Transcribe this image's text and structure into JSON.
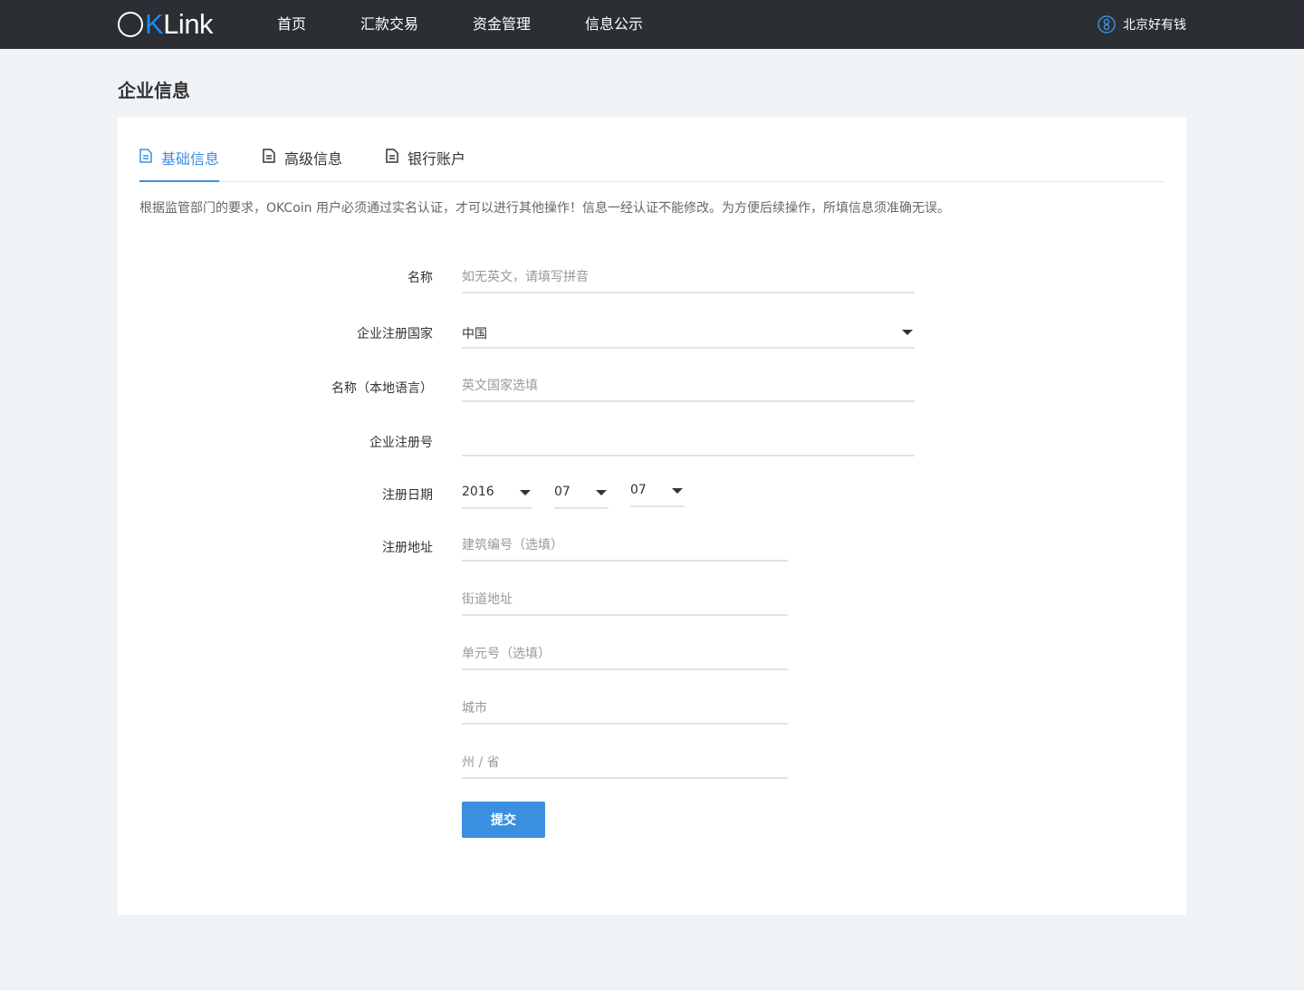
{
  "brand": {
    "logo_o": "O",
    "logo_k": "K",
    "logo_rest": "Link"
  },
  "nav": {
    "items": [
      {
        "label": "首页"
      },
      {
        "label": "汇款交易"
      },
      {
        "label": "资金管理"
      },
      {
        "label": "信息公示"
      }
    ],
    "user_name": "北京好有钱"
  },
  "page_title": "企业信息",
  "tabs": [
    {
      "label": "基础信息",
      "active": true
    },
    {
      "label": "高级信息",
      "active": false
    },
    {
      "label": "银行账户",
      "active": false
    }
  ],
  "notice": "根据监管部门的要求，OKCoin 用户必须通过实名认证，才可以进行其他操作！信息一经认证不能修改。为方便后续操作，所填信息须准确无误。",
  "form": {
    "name": {
      "label": "名称",
      "placeholder": "如无英文，请填写拼音",
      "value": ""
    },
    "country": {
      "label": "企业注册国家",
      "value": "中国"
    },
    "local_name": {
      "label": "名称（本地语言）",
      "placeholder": "英文国家选填",
      "value": ""
    },
    "reg_no": {
      "label": "企业注册号",
      "placeholder": "",
      "value": ""
    },
    "reg_date": {
      "label": "注册日期",
      "year": "2016",
      "month": "07",
      "day": "07"
    },
    "address": {
      "label": "注册地址",
      "building_placeholder": "建筑编号（选填）",
      "street_placeholder": "街道地址",
      "unit_placeholder": "单元号（选填）",
      "city_placeholder": "城市",
      "state_placeholder": "州 / 省"
    },
    "submit_label": "提交"
  },
  "colors": {
    "accent": "#3b8fe0",
    "topbar": "#2b2e33",
    "background": "#f0f3f6"
  }
}
